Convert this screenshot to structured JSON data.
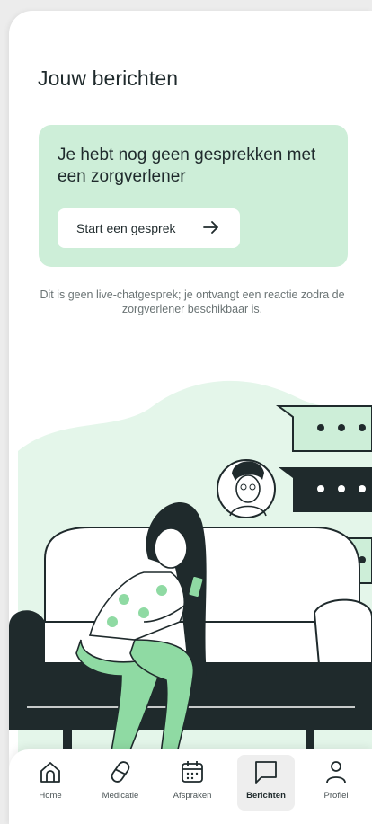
{
  "header": {
    "title": "Jouw berichten"
  },
  "empty_state": {
    "title": "Je hebt nog geen gesprekken met een zorgverlener",
    "button_label": "Start een gesprek",
    "button_icon": "arrow-right-icon"
  },
  "notice": "Dit is geen live-chatgesprek; je ontvangt een reactie zodra de zorgverlener beschikbaar is.",
  "tabbar": {
    "active": "Berichten",
    "items": [
      {
        "label": "Home",
        "icon": "home-icon"
      },
      {
        "label": "Medicatie",
        "icon": "pill-icon"
      },
      {
        "label": "Afspraken",
        "icon": "calendar-icon"
      },
      {
        "label": "Berichten",
        "icon": "chat-icon"
      },
      {
        "label": "Profiel",
        "icon": "user-icon"
      }
    ]
  },
  "colors": {
    "accent_green": "#cdeed8",
    "illustration_green": "#8fdaa3",
    "dark": "#1f2a2c",
    "text_muted": "#6b7475"
  }
}
